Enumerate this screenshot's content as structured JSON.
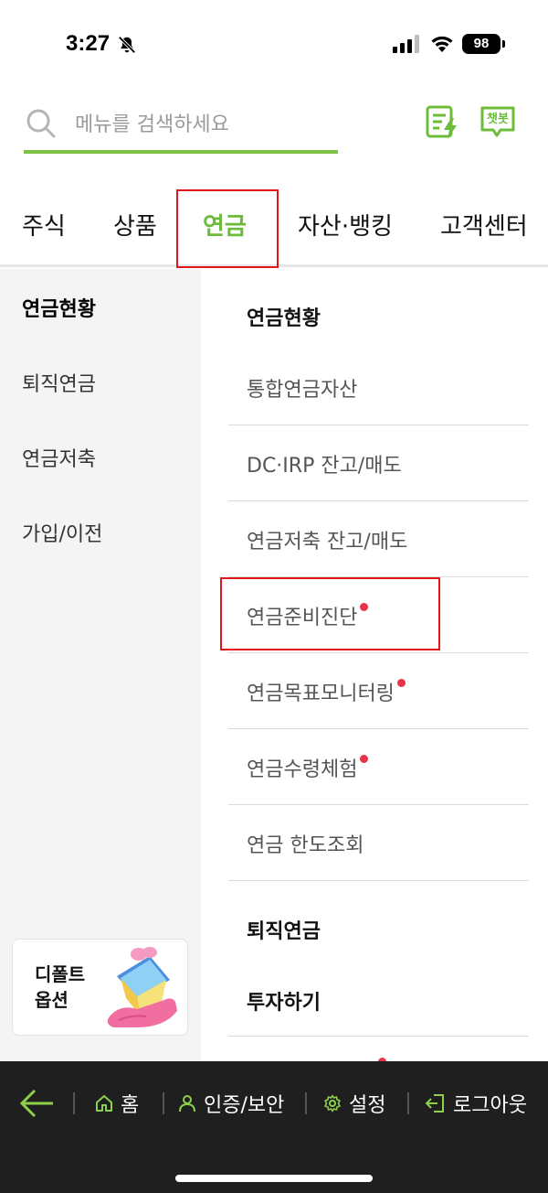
{
  "status_bar": {
    "time": "3:27",
    "battery": "98"
  },
  "search": {
    "placeholder": "메뉴를 검색하세요"
  },
  "header_icons": {
    "chatbot_label": "챗봇"
  },
  "tabs": [
    {
      "label": "주식"
    },
    {
      "label": "상품"
    },
    {
      "label": "연금",
      "active": true
    },
    {
      "label": "자산·뱅킹"
    },
    {
      "label": "고객센터"
    }
  ],
  "sidebar": {
    "items": [
      {
        "label": "연금현황",
        "active": true
      },
      {
        "label": "퇴직연금"
      },
      {
        "label": "연금저축"
      },
      {
        "label": "가입/이전"
      }
    ],
    "default_option": {
      "line1": "디폴트",
      "line2": "옵션"
    }
  },
  "content": {
    "section1_title": "연금현황",
    "section1_items": [
      {
        "label": "통합연금자산",
        "new": false
      },
      {
        "label": "DC·IRP 잔고/매도",
        "new": false
      },
      {
        "label": "연금저축 잔고/매도",
        "new": false
      },
      {
        "label": "연금준비진단",
        "new": true
      },
      {
        "label": "연금목표모니터링",
        "new": true
      },
      {
        "label": "연금수령체험",
        "new": true
      },
      {
        "label": "연금 한도조회",
        "new": false
      }
    ],
    "section2_title": "퇴직연금",
    "section2_sub": "투자하기"
  },
  "bottom_nav": {
    "home": "홈",
    "auth": "인증/보안",
    "settings": "설정",
    "logout": "로그아웃"
  },
  "colors": {
    "accent": "#7cc242",
    "active_tab": "#6dbb3a",
    "highlight": "#e0161c",
    "new_dot": "#e8334a",
    "bottom_bg": "#1f1f1f"
  }
}
